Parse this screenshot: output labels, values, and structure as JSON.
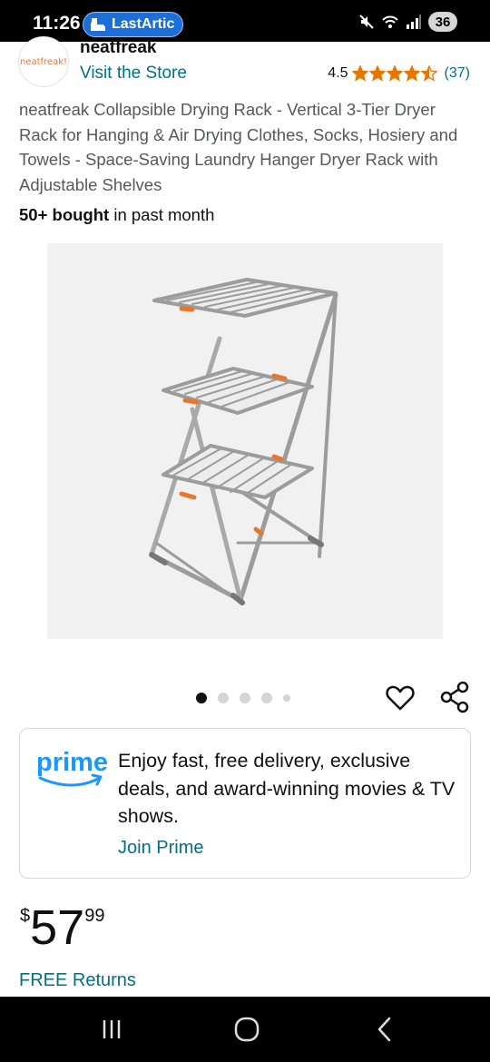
{
  "status": {
    "time": "11:26",
    "app_pill": "LastArtic",
    "battery": "36"
  },
  "store": {
    "logo_text": "neatfreak!",
    "name": "neatfreak",
    "visit_link": "Visit the Store"
  },
  "rating": {
    "value": "4.5",
    "stars": 4.5,
    "count": "(37)",
    "star_color": "#e77600"
  },
  "product": {
    "title": "neatfreak Collapsible Drying Rack - Vertical 3-Tier Dryer Rack for Hanging & Air Drying Clothes, Socks, Hosiery and Towels - Space-Saving Laundry Hanger Dryer Rack with Adjustable Shelves",
    "bought_bold": "50+ bought",
    "bought_rest": " in past month"
  },
  "carousel": {
    "total_dots": 5,
    "active_index": 0
  },
  "prime": {
    "logo_word": "prime",
    "message": "Enjoy fast, free delivery, exclusive deals, and award-winning movies & TV shows.",
    "join_label": "Join Prime",
    "brand_color": "#1a98ff"
  },
  "price": {
    "symbol": "$",
    "whole": "57",
    "fraction": "99"
  },
  "returns": {
    "label": "FREE Returns"
  },
  "colors": {
    "link": "#007185",
    "accent_orange": "#e8772e"
  }
}
